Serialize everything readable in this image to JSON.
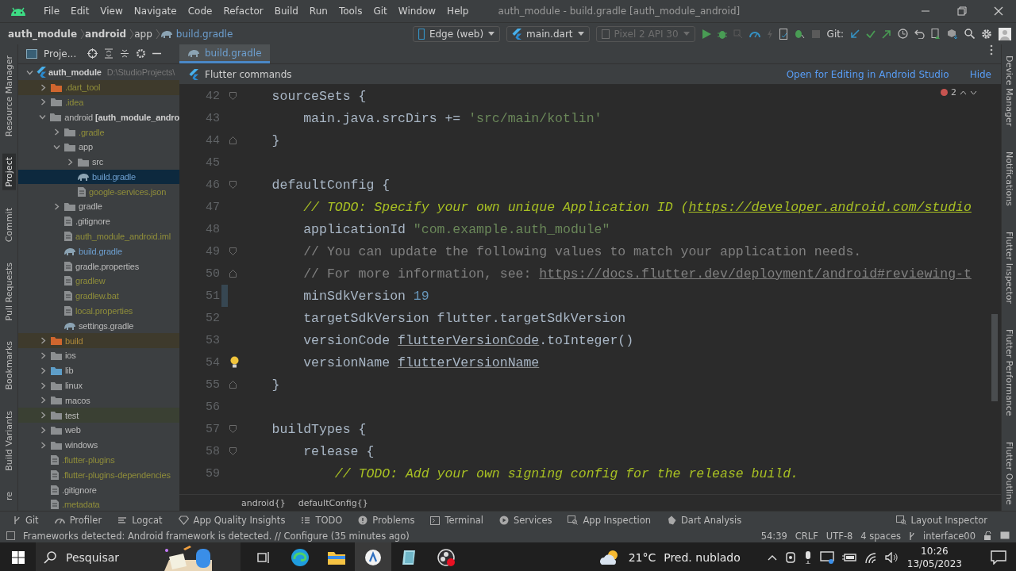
{
  "window": {
    "title": "auth_module - build.gradle [auth_module_android]"
  },
  "menu": [
    "File",
    "Edit",
    "View",
    "Navigate",
    "Code",
    "Refactor",
    "Build",
    "Run",
    "Tools",
    "Git",
    "Window",
    "Help"
  ],
  "breadcrumbs": [
    "auth_module",
    "android",
    "app",
    "build.gradle"
  ],
  "run_toolbar": {
    "device": "Edge (web)",
    "config": "main.dart",
    "emulator": "Pixel 2 API 30",
    "git_label": "Git:"
  },
  "left_strip": [
    {
      "label": "Resource Manager",
      "selected": false
    },
    {
      "label": "Project",
      "selected": true
    },
    {
      "label": "Commit",
      "selected": false
    },
    {
      "label": "Pull Requests",
      "selected": false
    },
    {
      "label": "Bookmarks",
      "selected": false
    },
    {
      "label": "Build Variants",
      "selected": false
    },
    {
      "label": "re",
      "selected": false
    }
  ],
  "project_panel": {
    "title": "Proje...",
    "tree": [
      {
        "name": "auth_module",
        "kind": "project",
        "path": "D:\\StudioProjects\\",
        "expanded": true,
        "selected": false,
        "children": [
          {
            "name": ".dart_tool",
            "kind": "folder",
            "color": "#8f8d3a",
            "excluded": true,
            "expanded": false,
            "selected": false
          },
          {
            "name": ".idea",
            "kind": "folder",
            "color": "#8f8d3a",
            "expanded": false,
            "selected": false
          },
          {
            "name": "android",
            "module": "[auth_module_andro",
            "kind": "folder",
            "expanded": true,
            "selected": false,
            "children": [
              {
                "name": ".gradle",
                "kind": "folder",
                "color": "#8f8d3a",
                "expanded": false,
                "selected": false
              },
              {
                "name": "app",
                "kind": "folder",
                "expanded": true,
                "selected": false,
                "children": [
                  {
                    "name": "src",
                    "kind": "folder",
                    "expanded": false,
                    "selected": false
                  },
                  {
                    "name": "build.gradle",
                    "kind": "gradle",
                    "color": "#6d9fcf",
                    "selected": true
                  },
                  {
                    "name": "google-services.json",
                    "kind": "file",
                    "color": "#8f8d3a",
                    "selected": false
                  }
                ]
              },
              {
                "name": "gradle",
                "kind": "folder",
                "expanded": false,
                "selected": false
              },
              {
                "name": ".gitignore",
                "kind": "file",
                "selected": false
              },
              {
                "name": "auth_module_android.iml",
                "kind": "file",
                "color": "#8f8d3a",
                "selected": false
              },
              {
                "name": "build.gradle",
                "kind": "gradle",
                "color": "#6d9fcf",
                "selected": false
              },
              {
                "name": "gradle.properties",
                "kind": "file",
                "selected": false
              },
              {
                "name": "gradlew",
                "kind": "file",
                "color": "#8f8d3a",
                "selected": false
              },
              {
                "name": "gradlew.bat",
                "kind": "file",
                "color": "#8f8d3a",
                "selected": false
              },
              {
                "name": "local.properties",
                "kind": "file",
                "color": "#8f8d3a",
                "selected": false
              },
              {
                "name": "settings.gradle",
                "kind": "gradle",
                "selected": false
              }
            ]
          },
          {
            "name": "build",
            "kind": "folder",
            "color": "#b08a3a",
            "excluded": true,
            "expanded": false,
            "selected": false
          },
          {
            "name": "ios",
            "kind": "folder",
            "expanded": false,
            "selected": false
          },
          {
            "name": "lib",
            "kind": "sources",
            "expanded": false,
            "selected": false
          },
          {
            "name": "linux",
            "kind": "folder",
            "expanded": false,
            "selected": false
          },
          {
            "name": "macos",
            "kind": "folder",
            "expanded": false,
            "selected": false
          },
          {
            "name": "test",
            "kind": "folder",
            "test": true,
            "expanded": false,
            "selected": false
          },
          {
            "name": "web",
            "kind": "folder",
            "expanded": false,
            "selected": false
          },
          {
            "name": "windows",
            "kind": "folder",
            "expanded": false,
            "selected": false
          },
          {
            "name": ".flutter-plugins",
            "kind": "file",
            "color": "#8f8d3a",
            "selected": false
          },
          {
            "name": ".flutter-plugins-dependencies",
            "kind": "file",
            "color": "#8f8d3a",
            "selected": false
          },
          {
            "name": ".gitignore",
            "kind": "file",
            "selected": false
          },
          {
            "name": ".metadata",
            "kind": "file",
            "color": "#8f8d3a",
            "selected": false
          }
        ]
      }
    ]
  },
  "editor": {
    "tab": {
      "label": "build.gradle",
      "selected": true
    },
    "banner": {
      "title": "Flutter commands",
      "action": "Open for Editing in Android Studio",
      "hide": "Hide"
    },
    "warnings": "2",
    "lines": [
      {
        "n": "42",
        "kind": "open",
        "tokens": [
          {
            "t": "    sourceSets {",
            "kind": "plain"
          }
        ]
      },
      {
        "n": "43",
        "kind": "plain",
        "tokens": [
          {
            "t": "        main.java.srcDirs += ",
            "kind": "plain"
          },
          {
            "t": "'src/main/kotlin'",
            "kind": "string"
          }
        ]
      },
      {
        "n": "44",
        "kind": "close",
        "tokens": [
          {
            "t": "    }",
            "kind": "plain"
          }
        ]
      },
      {
        "n": "45",
        "kind": "plain"
      },
      {
        "n": "46",
        "kind": "open",
        "tokens": [
          {
            "t": "    defaultConfig {",
            "kind": "plain"
          }
        ]
      },
      {
        "n": "47",
        "kind": "plain",
        "tokens": [
          {
            "t": "        // TODO: Specify your own unique Application ID (",
            "kind": "todo"
          },
          {
            "t": "https://developer.android.com/studio",
            "kind": "todo-link"
          }
        ]
      },
      {
        "n": "48",
        "kind": "plain",
        "tokens": [
          {
            "t": "        applicationId ",
            "kind": "plain"
          },
          {
            "t": "\"com.example.auth_module\"",
            "kind": "string"
          }
        ]
      },
      {
        "n": "49",
        "kind": "open",
        "tokens": [
          {
            "t": "        // You can update the following values to match your application needs.",
            "kind": "comment"
          }
        ]
      },
      {
        "n": "50",
        "kind": "close",
        "tokens": [
          {
            "t": "        // For more information, see: ",
            "kind": "comment"
          },
          {
            "t": "https://docs.flutter.dev/deployment/android#reviewing-t",
            "kind": "comment-link"
          }
        ]
      },
      {
        "n": "51",
        "kind": "plain",
        "changed": true,
        "tokens": [
          {
            "t": "        minSdkVersion ",
            "kind": "plain"
          },
          {
            "t": "19",
            "kind": "number"
          }
        ]
      },
      {
        "n": "52",
        "kind": "plain",
        "tokens": [
          {
            "t": "        targetSdkVersion flutter.targetSdkVersion",
            "kind": "plain"
          }
        ]
      },
      {
        "n": "53",
        "kind": "plain",
        "tokens": [
          {
            "t": "        versionCode ",
            "kind": "plain"
          },
          {
            "t": "flutterVersionCode",
            "kind": "underlined"
          },
          {
            "t": ".toInteger()",
            "kind": "plain"
          }
        ]
      },
      {
        "n": "54",
        "kind": "plain",
        "bulb": true,
        "tokens": [
          {
            "t": "        versionName ",
            "kind": "plain"
          },
          {
            "t": "flutterVersionName",
            "kind": "underlined"
          }
        ]
      },
      {
        "n": "55",
        "kind": "close",
        "tokens": [
          {
            "t": "    }",
            "kind": "plain"
          }
        ]
      },
      {
        "n": "56",
        "kind": "plain"
      },
      {
        "n": "57",
        "kind": "open",
        "tokens": [
          {
            "t": "    buildTypes {",
            "kind": "plain"
          }
        ]
      },
      {
        "n": "58",
        "kind": "open",
        "tokens": [
          {
            "t": "        release {",
            "kind": "plain"
          }
        ]
      },
      {
        "n": "59",
        "kind": "plain",
        "tokens": [
          {
            "t": "            // TODO: Add your own signing config for the release build.",
            "kind": "todo"
          }
        ]
      }
    ],
    "breadcrumbs": [
      "android{}",
      "defaultConfig{}"
    ]
  },
  "right_strip": [
    "Device Manager",
    "Notifications",
    "Flutter Inspector",
    "Flutter Performance",
    "Flutter Outline"
  ],
  "tool_windows": [
    "Git",
    "Profiler",
    "Logcat",
    "App Quality Insights",
    "TODO",
    "Problems",
    "Terminal",
    "Services",
    "App Inspection",
    "Dart Analysis"
  ],
  "tool_windows_right": [
    "Layout Inspector"
  ],
  "status_bar": {
    "message": "Frameworks detected: Android framework is detected. // Configure (35 minutes ago)",
    "position": "54:39",
    "line_ending": "CRLF",
    "encoding": "UTF-8",
    "indent": "4 spaces",
    "branch": "interface00"
  },
  "taskbar": {
    "search_placeholder": "Pesquisar",
    "temperature": "21°C",
    "weather": "Pred. nublado",
    "time": "10:26",
    "date": "13/05/2023"
  }
}
